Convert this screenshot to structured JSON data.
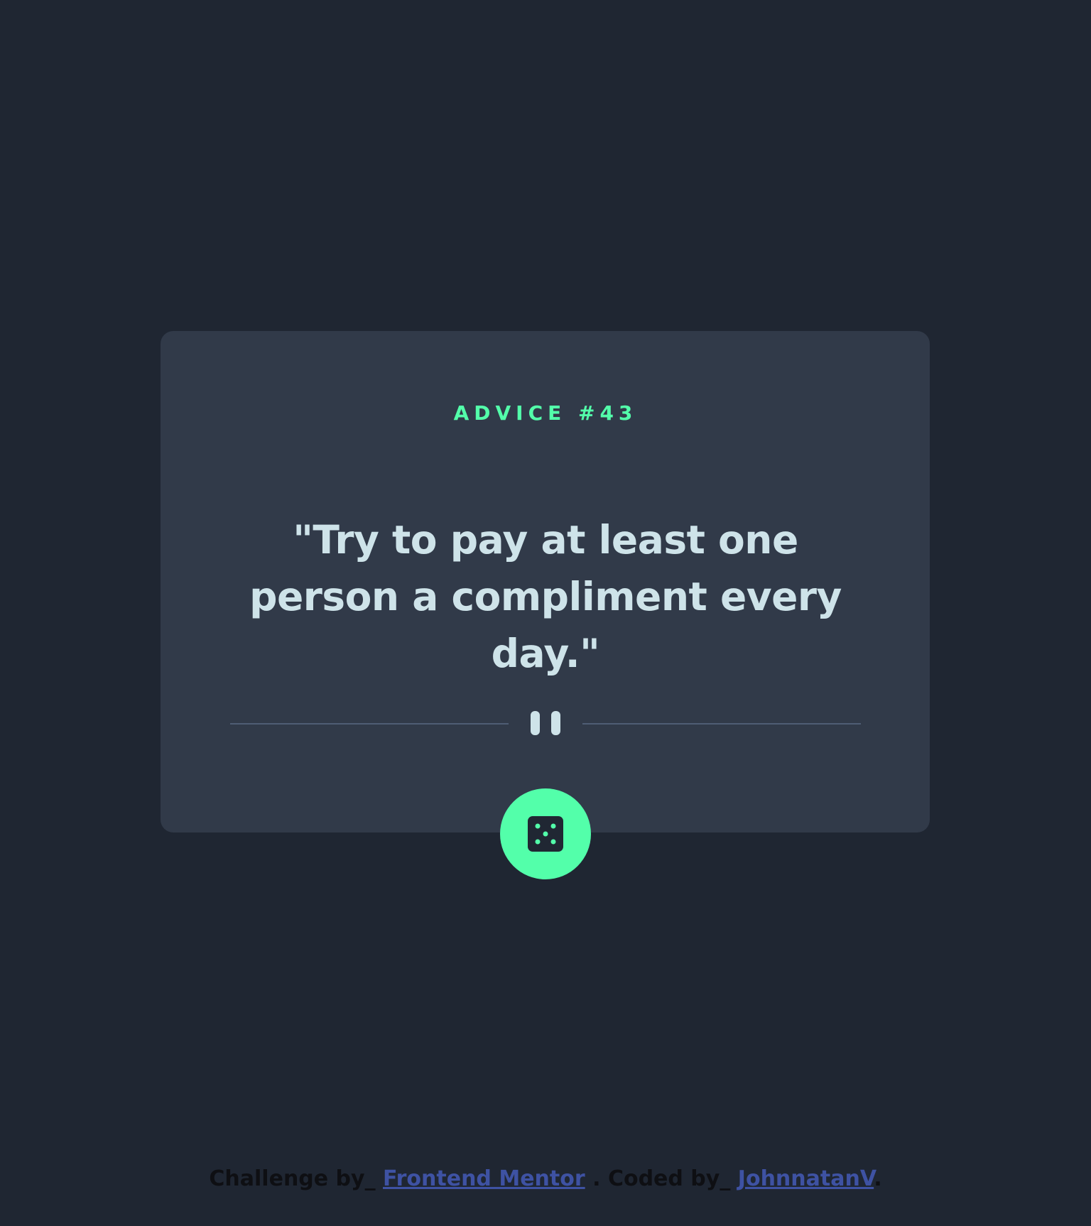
{
  "advice": {
    "title": "ADVICE #43",
    "quote": "\"Try to pay at least one person a compliment every day.\""
  },
  "icons": {
    "divider": "pause-icon",
    "button": "dice-icon"
  },
  "footer": {
    "challenge_prefix": "Challenge by_ ",
    "challenge_link": "Frontend Mentor",
    "coded_prefix": " . Coded by_ ",
    "coded_link": "JohnnatanV",
    "suffix": "."
  },
  "colors": {
    "background": "#1f2632",
    "card": "#313a49",
    "accent": "#53ffaa",
    "text": "#cee3e9",
    "divider": "#4f5d74",
    "link": "#3e52a3"
  }
}
